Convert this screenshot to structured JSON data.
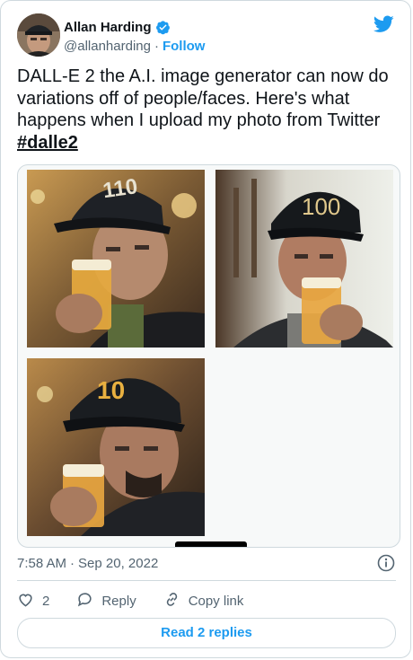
{
  "author": {
    "name": "Allan Harding",
    "handle": "@allanharding",
    "separator": "·",
    "follow_label": "Follow"
  },
  "tweet": {
    "text": "DALL-E 2 the A.I. image generator can now do variations off of people/faces. Here's what happens when I upload my photo from Twitter ",
    "hashtag": "#dalle2"
  },
  "media": {
    "images": [
      {
        "description": "man in black cap drinking beer",
        "cap_text": "110"
      },
      {
        "description": "man in black cap drinking beer",
        "cap_text": "100"
      },
      {
        "description": "man in black cap drinking beer",
        "cap_text": "10"
      }
    ]
  },
  "meta": {
    "time": "7:58 AM",
    "separator": "·",
    "date": "Sep 20, 2022"
  },
  "actions": {
    "like_count": "2",
    "reply_label": "Reply",
    "copy_link_label": "Copy link"
  },
  "read_replies_label": "Read 2 replies",
  "colors": {
    "accent": "#1d9bf0",
    "text": "#0f1419",
    "secondary": "#536471",
    "border": "#cfd9de"
  },
  "icons": [
    "verified-badge-icon",
    "twitter-bird-icon",
    "info-icon",
    "heart-icon",
    "reply-bubble-icon",
    "link-icon"
  ]
}
